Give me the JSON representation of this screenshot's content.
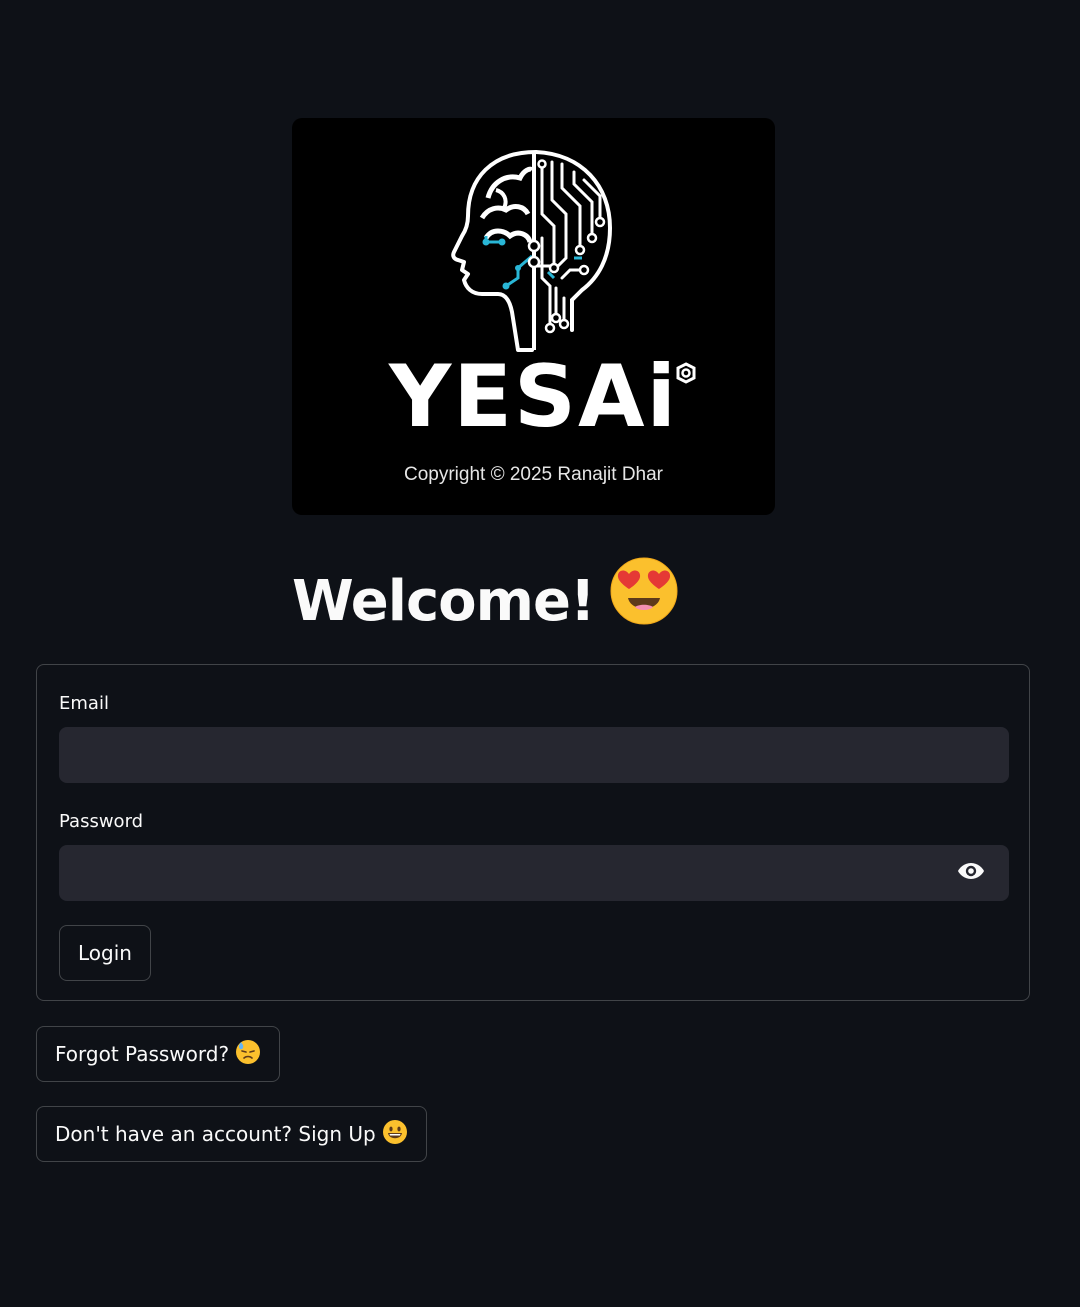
{
  "logo": {
    "wordmark": "YESAi",
    "copyright": "Copyright © 2025 Ranajit Dhar"
  },
  "heading": {
    "text": "Welcome!",
    "emoji": "smiling-face-with-heart-eyes"
  },
  "form": {
    "email_label": "Email",
    "email_value": "",
    "password_label": "Password",
    "password_value": "",
    "password_toggle_icon": "eye-icon",
    "login_label": "Login"
  },
  "links": {
    "forgot_label": "Forgot Password?",
    "forgot_emoji": "downcast-face-with-sweat",
    "signup_label": "Don't have an account? Sign Up",
    "signup_emoji": "grinning-face"
  },
  "colors": {
    "background": "#0e1117",
    "input_background": "#262730",
    "text": "#fafafa",
    "logo_accent": "#29b6d6",
    "emoji_yellow": "#fbc02d"
  }
}
